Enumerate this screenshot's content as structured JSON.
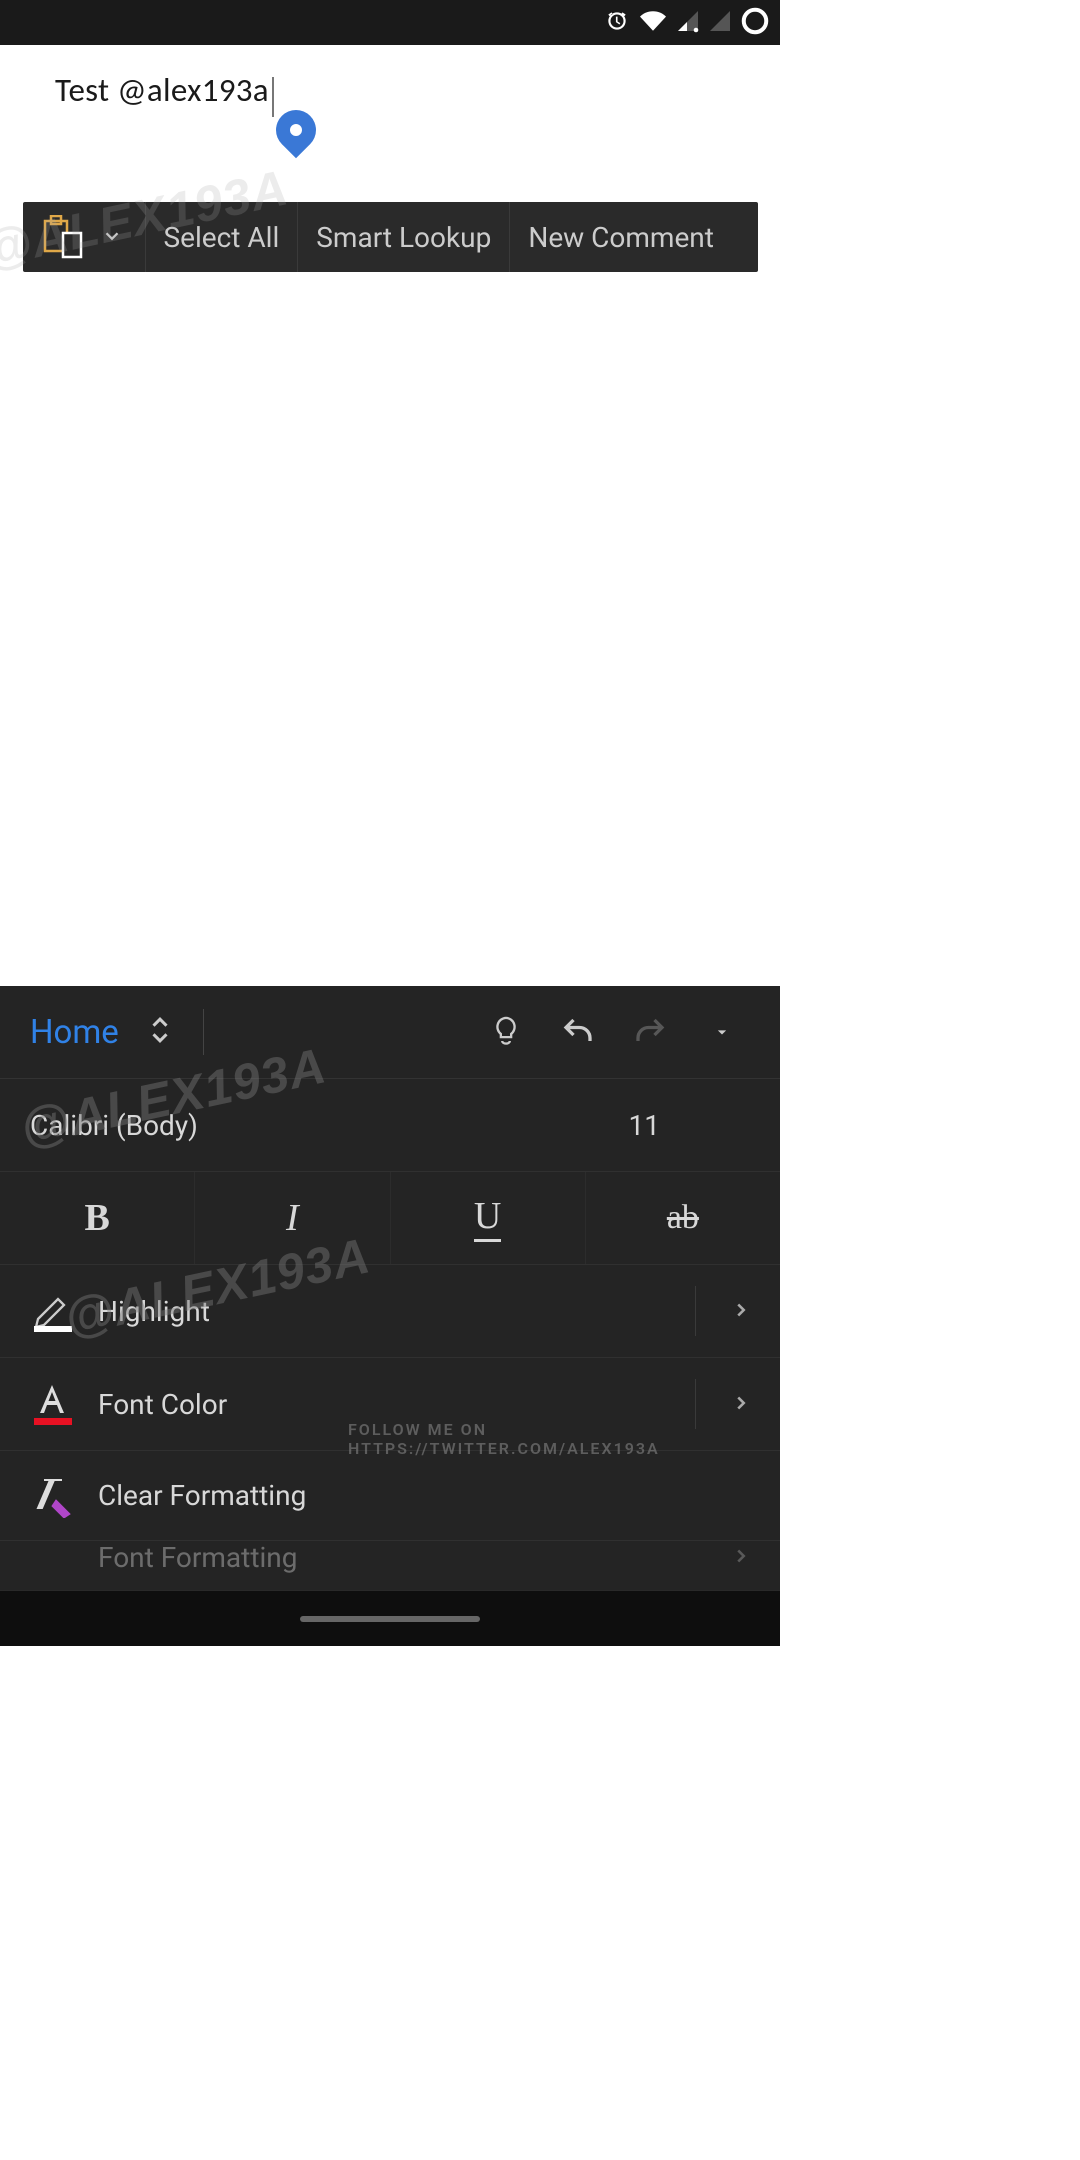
{
  "document": {
    "text": "Test @alex193a"
  },
  "context_menu": {
    "select_all": "Select All",
    "smart_lookup": "Smart Lookup",
    "new_comment": "New Comment"
  },
  "panel": {
    "tab": "Home",
    "font_name": "Calibri (Body)",
    "font_size": "11",
    "bold": "B",
    "italic": "I",
    "underline": "U",
    "strike": "ab",
    "highlight": "Highlight",
    "font_color": "Font Color",
    "clear_formatting": "Clear Formatting",
    "font_formatting": "Font Formatting"
  },
  "watermark": {
    "handle": "@ALEX193A",
    "follow": "FOLLOW ME ON HTTPS://TWITTER.COM/ALEX193A"
  }
}
